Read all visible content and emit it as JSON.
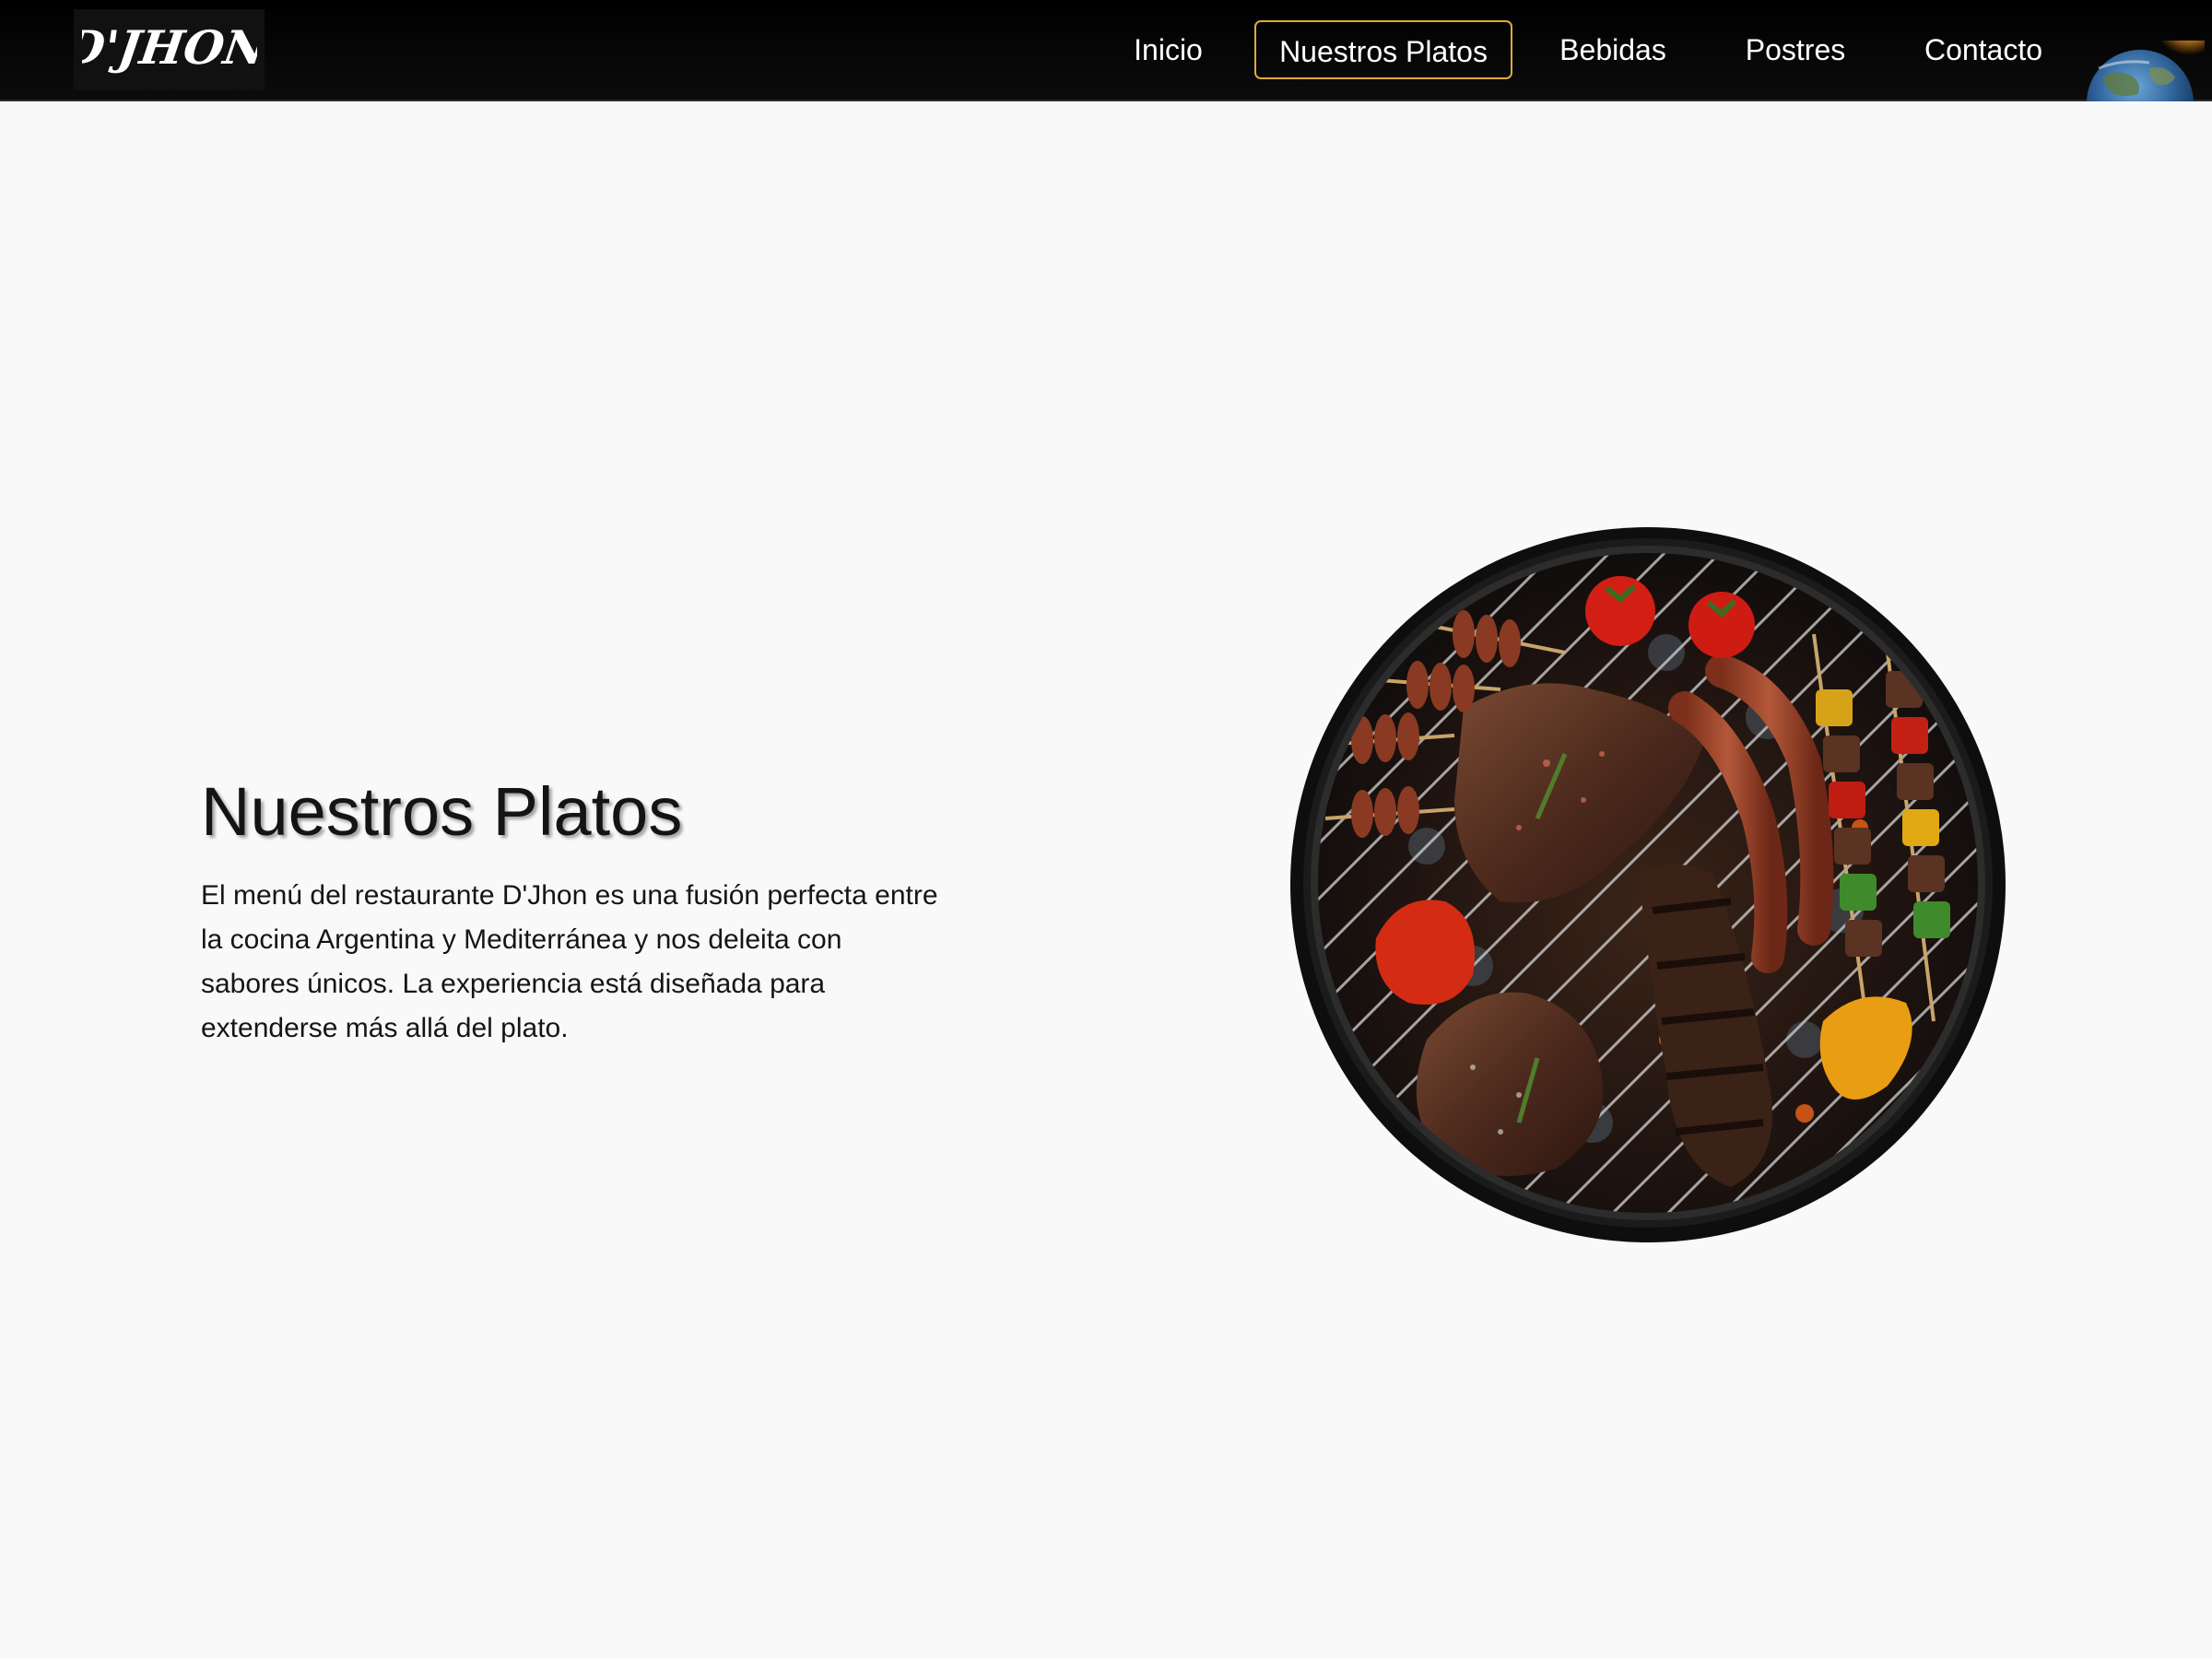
{
  "brand": {
    "logo_text": "D'JHON",
    "accent_color": "#e0a93a"
  },
  "nav": {
    "items": [
      {
        "label": "Inicio",
        "active": false
      },
      {
        "label": "Nuestros Platos",
        "active": true
      },
      {
        "label": "Bebidas",
        "active": false
      },
      {
        "label": "Postres",
        "active": false
      },
      {
        "label": "Contacto",
        "active": false
      }
    ],
    "globe_icon": "globe-icon"
  },
  "hero": {
    "title": "Nuestros Platos",
    "description": "El menú del restaurante D'Jhon es una fusión perfecta entre la cocina Argentina y Mediterránea y nos deleita con sabores únicos. La experiencia está diseñada para extenderse más allá del plato.",
    "image_icon": "grill-food-image"
  }
}
